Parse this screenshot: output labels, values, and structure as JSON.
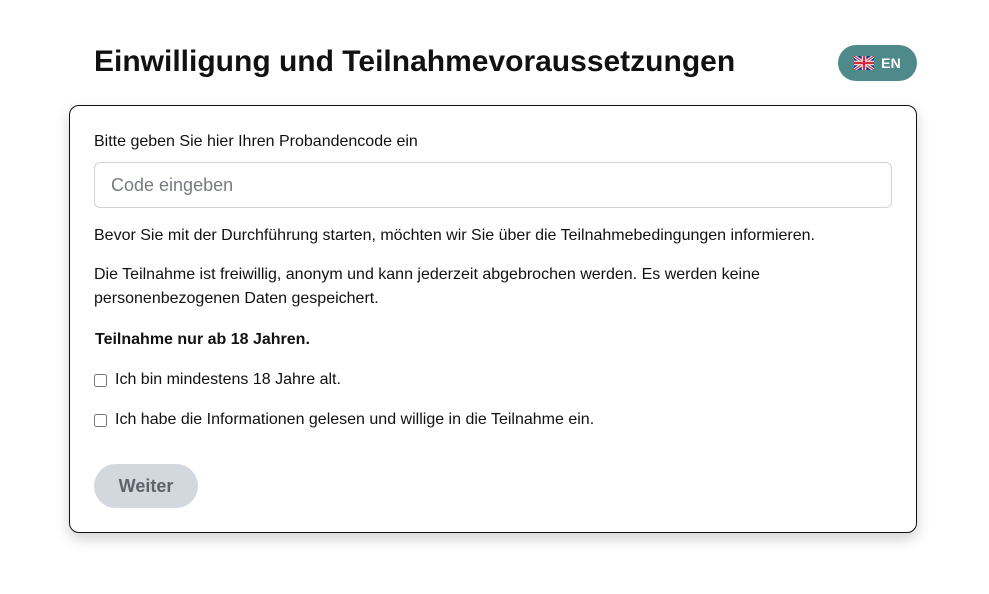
{
  "page": {
    "title": "Einwilligung und Teilnahmevoraussetzungen"
  },
  "language_toggle": {
    "label": "EN",
    "flag_icon": "uk-flag-icon",
    "background_color": "#4f8a8b"
  },
  "form": {
    "code_label": "Bitte geben Sie hier Ihren Probandencode ein",
    "code_input": {
      "value": "",
      "placeholder": "Code eingeben"
    },
    "intro_text": "Bevor Sie mit der Durchführung starten, möchten wir Sie über die Teilnahmebedingungen informieren.",
    "voluntary_text": "Die Teilnahme ist freiwillig, anonym und kann jederzeit abgebrochen werden. Es werden keine personenbezogenen Daten gespeichert.",
    "age_note": "Teilnahme nur ab 18 Jahren.",
    "checkboxes": [
      {
        "label": "Ich bin mindestens 18 Jahre alt.",
        "checked": false
      },
      {
        "label": "Ich habe die Informationen gelesen und willige in die Teilnahme ein.",
        "checked": false
      }
    ],
    "next_button": {
      "label": "Weiter",
      "disabled": true
    }
  }
}
